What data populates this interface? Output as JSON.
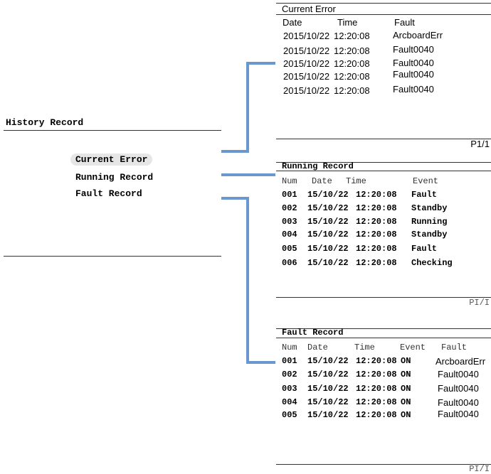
{
  "history_menu": {
    "title": "History Record",
    "items": [
      "Current Error",
      "Running Record",
      "Fault Record"
    ],
    "selected_index": 0
  },
  "current_error": {
    "title": "Current Error",
    "headers": [
      "Date",
      "Time",
      "Fault"
    ],
    "rows": [
      [
        "2015/10/22",
        "12:20:08",
        "ArcboardErr"
      ],
      [
        "2015/10/22",
        "12:20:08",
        "Fault0040"
      ],
      [
        "2015/10/22",
        "12:20:08",
        "Fault0040"
      ],
      [
        "2015/10/22",
        "12:20:08",
        "Fault0040"
      ],
      [
        "2015/10/22",
        "12:20:08",
        "Fault0040"
      ]
    ],
    "page": "P1/1"
  },
  "running_record": {
    "title": "Running Record",
    "headers": [
      "Num",
      "Date",
      "Time",
      "Event"
    ],
    "rows": [
      [
        "001",
        "15/10/22",
        "12:20:08",
        "Fault"
      ],
      [
        "002",
        "15/10/22",
        "12:20:08",
        "Standby"
      ],
      [
        "003",
        "15/10/22",
        "12:20:08",
        "Running"
      ],
      [
        "004",
        "15/10/22",
        "12:20:08",
        "Standby"
      ],
      [
        "005",
        "15/10/22",
        "12:20:08",
        "Fault"
      ],
      [
        "006",
        "15/10/22",
        "12:20:08",
        "Checking"
      ]
    ],
    "page": "PI/I"
  },
  "fault_record": {
    "title": "Fault Record",
    "headers": [
      "Num",
      "Date",
      "Time",
      "Event",
      "Fault"
    ],
    "rows": [
      [
        "001",
        "15/10/22",
        "12:20:08",
        "ON",
        "ArcboardErr"
      ],
      [
        "002",
        "15/10/22",
        "12:20:08",
        "ON",
        "Fault0040"
      ],
      [
        "003",
        "15/10/22",
        "12:20:08",
        "ON",
        "Fault0040"
      ],
      [
        "004",
        "15/10/22",
        "12:20:08",
        "ON",
        "Fault0040"
      ],
      [
        "005",
        "15/10/22",
        "12:20:08",
        "ON",
        "Fault0040"
      ]
    ],
    "page": "PI/I"
  },
  "colors": {
    "connector": "#6a97cf",
    "selection_highlight": "#e6e6e6",
    "divider": "#333333"
  }
}
